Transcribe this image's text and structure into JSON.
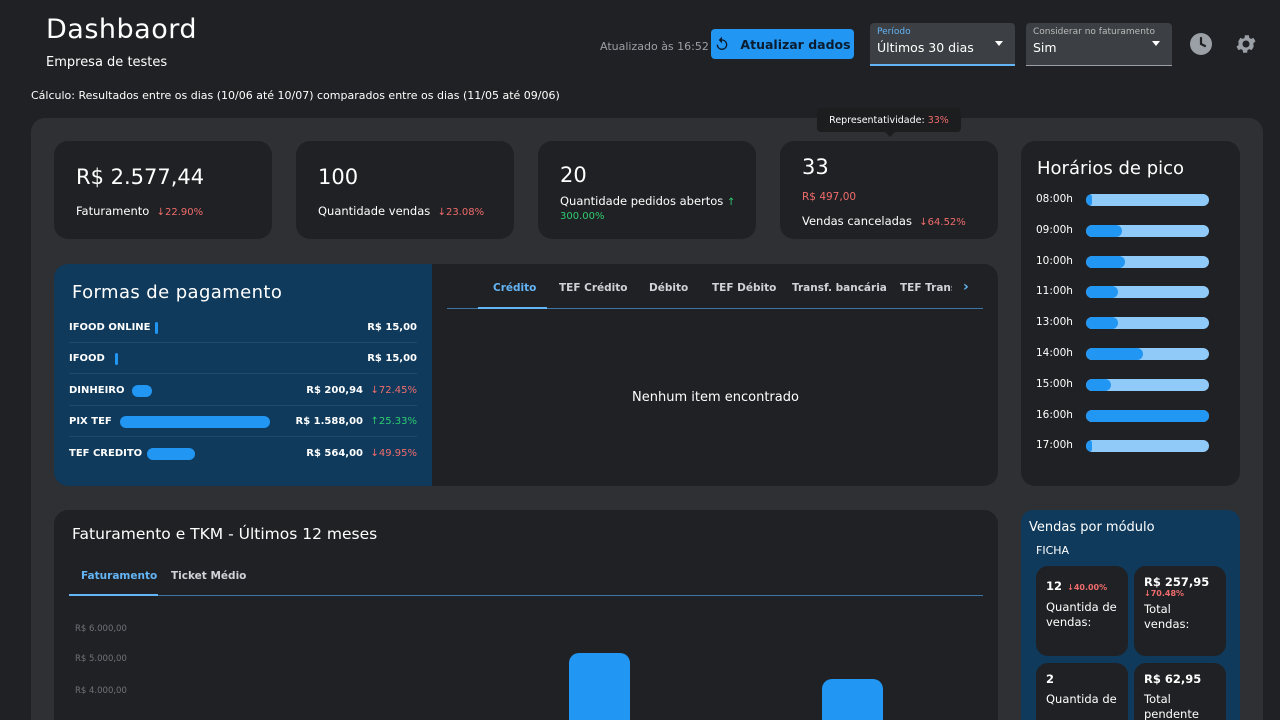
{
  "header": {
    "title": "Dashbaord",
    "subtitle": "Empresa de testes",
    "calc_text": "Cálculo: Resultados entre os dias (10/06 até 10/07) comparados entre os dias (11/05 até 09/06)",
    "updated": "Atualizado às 16:52",
    "refresh_label": "Atualizar dados",
    "period_label": "Período",
    "period_value": "Últimos 30 dias",
    "billing_label": "Considerar no faturamento",
    "billing_value": "Sim",
    "history_icon": "history-icon",
    "settings_icon": "gear-icon"
  },
  "kpis": [
    {
      "value": "R$ 2.577,44",
      "label": "Faturamento",
      "change": "↓22.90%",
      "trend": "down"
    },
    {
      "value": "100",
      "label": "Quantidade vendas",
      "change": "↓23.08%",
      "trend": "down"
    },
    {
      "value": "20",
      "label": "Quantidade pedidos abertos",
      "change_a": "↑",
      "change_b": "300.00%",
      "trend": "up"
    },
    {
      "value": "33",
      "sub": "R$ 497,00",
      "label": "Vendas canceladas",
      "change": "↓64.52%",
      "trend": "down"
    }
  ],
  "tooltip": {
    "label": "Representatividade:",
    "value": "33%"
  },
  "payments": {
    "title": "Formas de pagamento",
    "rows": [
      {
        "name": "IFOOD ONLINE",
        "amount": "R$ 15,00",
        "change": "",
        "share": 0.01
      },
      {
        "name": "IFOOD",
        "amount": "R$ 15,00",
        "change": "",
        "share": 0.01
      },
      {
        "name": "DINHEIRO",
        "amount": "R$ 200,94",
        "change": "↓72.45%",
        "share": 0.12
      },
      {
        "name": "PIX TEF",
        "amount": "R$ 1.588,00",
        "change": "↑25.33%",
        "share": 1.0
      },
      {
        "name": "TEF CREDITO",
        "amount": "R$ 564,00",
        "change": "↓49.95%",
        "share": 0.36
      }
    ],
    "tabs": [
      "Crédito",
      "TEF Crédito",
      "Débito",
      "TEF Débito",
      "Transf. bancária",
      "TEF Transf"
    ],
    "active_tab": "Crédito",
    "empty_text": "Nenhum item encontrado",
    "next_icon": "chevron-right-icon"
  },
  "peak_hours": {
    "title": "Horários de pico",
    "rows": [
      {
        "hour": "08:00h",
        "level": 0.05
      },
      {
        "hour": "09:00h",
        "level": 0.29
      },
      {
        "hour": "10:00h",
        "level": 0.32
      },
      {
        "hour": "11:00h",
        "level": 0.26
      },
      {
        "hour": "13:00h",
        "level": 0.26
      },
      {
        "hour": "14:00h",
        "level": 0.46
      },
      {
        "hour": "15:00h",
        "level": 0.2
      },
      {
        "hour": "16:00h",
        "level": 1.0
      },
      {
        "hour": "17:00h",
        "level": 0.05
      }
    ]
  },
  "billing_chart": {
    "title": "Faturamento e TKM - Últimos 12 meses",
    "tabs": [
      "Faturamento",
      "Ticket Médio"
    ],
    "active_tab": "Faturamento"
  },
  "chart_data": {
    "type": "bar",
    "ytick_labels": [
      "R$ 6.000,00",
      "R$ 5.000,00",
      "R$ 4.000,00"
    ],
    "ylim_visible": [
      4000,
      6000
    ],
    "series": [
      {
        "values": [
          5250,
          4400
        ]
      }
    ],
    "note_visible": "two bars partially visible; remaining values cropped"
  },
  "modules": {
    "title": "Vendas por módulo",
    "subtitle": "FICHA",
    "cards": [
      {
        "value": "12",
        "change": "↓40.00%",
        "label": "Quantida de vendas:"
      },
      {
        "value": "R$ 257,95",
        "change": "↓70.48%",
        "label": "Total vendas:"
      },
      {
        "value": "2",
        "change": "",
        "label": "Quantida de"
      },
      {
        "value": "R$ 62,95",
        "change": "",
        "label": "Total pendente"
      }
    ]
  }
}
